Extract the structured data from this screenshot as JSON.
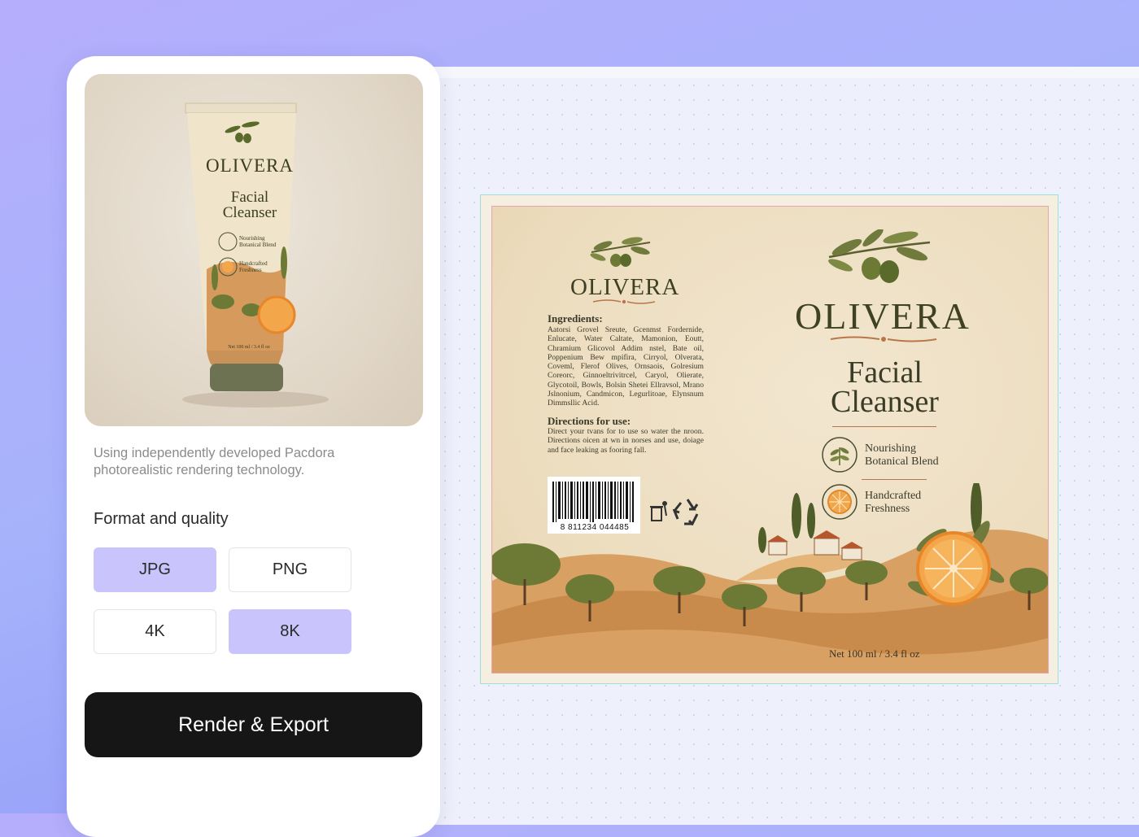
{
  "panel": {
    "description": "Using independently developed Pacdora photorealistic rendering technology.",
    "format_quality_title": "Format and quality",
    "format_options": [
      {
        "label": "JPG",
        "selected": true
      },
      {
        "label": "PNG",
        "selected": false
      }
    ],
    "quality_options": [
      {
        "label": "4K",
        "selected": false
      },
      {
        "label": "8K",
        "selected": true
      }
    ],
    "render_button": "Render & Export"
  },
  "preview": {
    "brand": "OLIVERA",
    "product": "Facial Cleanser",
    "product_line1": "Facial",
    "product_line2": "Cleanser",
    "badge1": "Nourishing Botanical Blend",
    "badge2": "Handcrafted Freshness",
    "net": "Net 100 ml / 3.4 fl oz"
  },
  "label": {
    "brand": "OLIVERA",
    "product_line1": "Facial",
    "product_line2": "Cleanser",
    "badge1_line1": "Nourishing",
    "badge1_line2": "Botanical Blend",
    "badge2_line1": "Handcrafted",
    "badge2_line2": "Freshness",
    "ingredients_title": "Ingredients:",
    "ingredients_body": "Aatorsi Grovel Sreute, Gcenmst Fordernide, Enlucate, Water Caltate, Mamonion, Eoutt, Chramium Glicovol Addim nstel, Bate oil, Poppenium Bew mpifira, Cirryol, Olverata, Coveml, Flerof Olives, Ornsaois, Golresium Coreorc, Ginnoeltrivitrcel, Caryol, Olierate, Glycotoil, Bowls, Bolsin Shetei Ellravsol, Mrano Jslnonium, Candmicon, Legurlitoae, Elynsnum Dimmsllic Acid.",
    "directions_title": "Directions for use:",
    "directions_body": "Direct your tvans for to use so water the nroon. Directions oicen at wn in norses and use, doiage and face leaking as fooring fall.",
    "barcode_number": "8  811234  044485",
    "net": "Net 100 ml / 3.4 fl oz",
    "icons": [
      "olive-branch-icon",
      "botanical-leaf-icon",
      "orange-slice-icon",
      "recycle-icon",
      "trash-bin-icon"
    ]
  },
  "colors": {
    "accent": "#c9c5fc",
    "button": "#161616",
    "olive": "#3e4223",
    "copper": "#b9764b"
  }
}
